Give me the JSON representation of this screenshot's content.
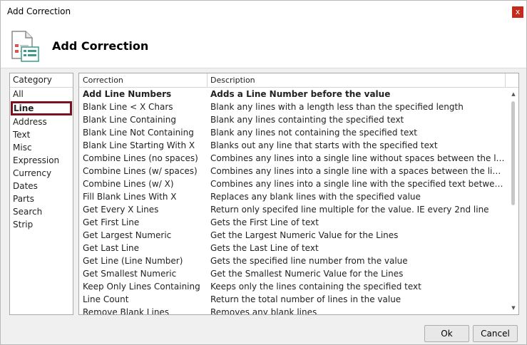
{
  "window": {
    "title": "Add Correction",
    "close_glyph": "x"
  },
  "header": {
    "title": "Add Correction",
    "icon": "document-list-icon"
  },
  "category": {
    "header": "Category",
    "items": [
      {
        "label": "All",
        "selected": false
      },
      {
        "label": "Line",
        "selected": true
      },
      {
        "label": "Address",
        "selected": false
      },
      {
        "label": "Text",
        "selected": false
      },
      {
        "label": "Misc",
        "selected": false
      },
      {
        "label": "Expression",
        "selected": false
      },
      {
        "label": "Currency",
        "selected": false
      },
      {
        "label": "Dates",
        "selected": false
      },
      {
        "label": "Parts",
        "selected": false
      },
      {
        "label": "Search",
        "selected": false
      },
      {
        "label": "Strip",
        "selected": false
      }
    ]
  },
  "grid": {
    "columns": [
      "Correction",
      "Description"
    ],
    "rows": [
      [
        "Add Line Numbers",
        "Adds a Line Number before the value"
      ],
      [
        "Blank Line < X Chars",
        "Blank any lines with a length less than the specified length"
      ],
      [
        "Blank Line Containing",
        "Blank any lines containting the specified text"
      ],
      [
        "Blank Line Not Containing",
        "Blank any lines not containing the specified text"
      ],
      [
        "Blank Line Starting With X",
        "Blanks out any line that starts with the specified text"
      ],
      [
        "Combine Lines (no spaces)",
        "Combines any lines into a single line without spaces between the line parts"
      ],
      [
        "Combine Lines (w/ spaces)",
        "Combines any lines into a single line with a spaces between the line parts"
      ],
      [
        "Combine Lines (w/ X)",
        "Combines any lines into a single line with the specified text between the..."
      ],
      [
        "Fill Blank Lines With X",
        "Replaces any blank lines with the specified value"
      ],
      [
        "Get Every X Lines",
        "Return only specifed line multiple for the value. IE every 2nd line"
      ],
      [
        "Get First Line",
        "Gets the First Line of text"
      ],
      [
        "Get Largest Numeric",
        "Get the Largest Numeric Value for the Lines"
      ],
      [
        "Get Last Line",
        "Gets the Last Line of text"
      ],
      [
        "Get Line (Line Number)",
        "Gets the specified line number from the value"
      ],
      [
        "Get Smallest Numeric",
        "Get the Smallest Numeric Value for the Lines"
      ],
      [
        "Keep Only Lines Containing",
        "Keeps only the lines containing the specified text"
      ],
      [
        "Line Count",
        "Return the total number of lines in the value"
      ],
      [
        "Remove Blank Lines",
        "Removes any blank lines"
      ]
    ]
  },
  "buttons": {
    "ok": "Ok",
    "cancel": "Cancel"
  },
  "colors": {
    "selection_border": "#7a1220",
    "close_bg": "#c42b1c"
  }
}
